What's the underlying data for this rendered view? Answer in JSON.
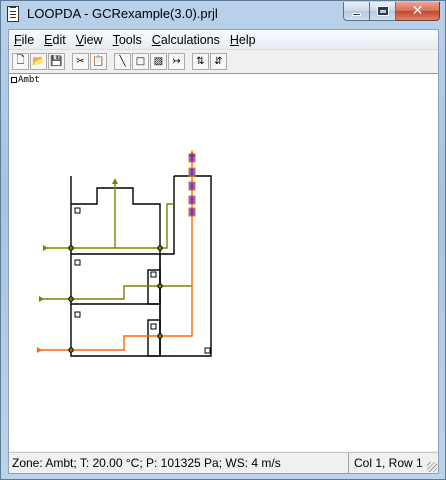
{
  "window": {
    "title": "LOOPDA - GCRexample(3.0).prjl",
    "close_symbol": "✕"
  },
  "menu": [
    {
      "label": "File",
      "accel": "F",
      "rest": "ile"
    },
    {
      "label": "Edit",
      "accel": "E",
      "rest": "dit"
    },
    {
      "label": "View",
      "accel": "V",
      "rest": "iew"
    },
    {
      "label": "Tools",
      "accel": "T",
      "rest": "ools"
    },
    {
      "label": "Calculations",
      "accel": "C",
      "rest": "alculations"
    },
    {
      "label": "Help",
      "accel": "H",
      "rest": "elp"
    }
  ],
  "toolbar": {
    "icons": [
      "new-file-icon",
      "open-folder-icon",
      "save-icon",
      "cut-icon",
      "paste-icon",
      "line-tool-icon",
      "rectangle-tool-icon",
      "hatch-tool-icon",
      "arrow-tool-icon",
      "move-up-icon",
      "move-down-icon"
    ],
    "glyphs": [
      "🗋",
      "📂",
      "💾",
      "✂",
      "📋",
      "╲",
      "□",
      "▧",
      "↣",
      "⇅",
      "⇵"
    ]
  },
  "canvas": {
    "zone_label": "Ambt",
    "colors": {
      "wall": "#000000",
      "olive_path": "#808000",
      "orange_path": "#ff6600",
      "shaft_marker": "#0000ff"
    }
  },
  "status": {
    "zone_info": "Zone: Ambt; T: 20.00 °C; P: 101325 Pa; WS: 4 m/s",
    "position": "Col 1, Row 1"
  }
}
